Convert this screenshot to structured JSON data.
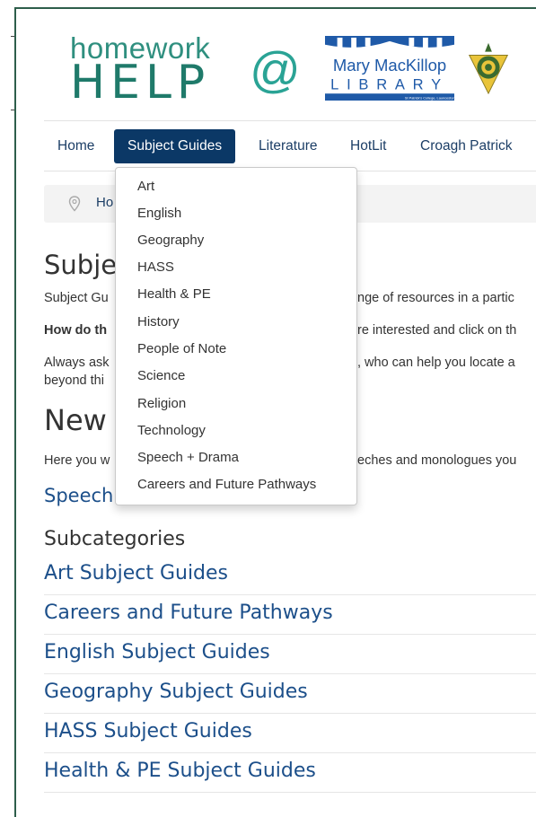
{
  "header": {
    "homework_word": "homework",
    "help_word": "HELP",
    "at_sign": "@",
    "library_name_line1": "Mary MacKillop",
    "library_name_line2": "LIBRARY",
    "library_subtext": "St Patrick's College, Launceston",
    "colors": {
      "brand_green": "#2f8f7f",
      "nav_active": "#0b3866",
      "link_blue": "#1c4f8a"
    }
  },
  "nav": {
    "items": [
      "Home",
      "Subject Guides",
      "Literature",
      "HotLit",
      "Croagh Patrick"
    ],
    "active": "Subject Guides"
  },
  "dropdown": {
    "items": [
      "Art",
      "English",
      "Geography",
      "HASS",
      "Health & PE",
      "History",
      "People of Note",
      "Science",
      "Religion",
      "Technology",
      "Speech + Drama",
      "Careers and Future Pathways"
    ]
  },
  "breadcrumb": {
    "icon": "location-pin-icon",
    "text": "Ho"
  },
  "main": {
    "title": "Subjec",
    "intro_left": "Subject Gu",
    "intro_right": "nge of resources in a partic",
    "how_left": "How do th",
    "how_right": "re interested and click on th",
    "always_left": "Always ask",
    "always_right": ", who can help you locate a",
    "beyond_left": "beyond thi",
    "new_heading": "New",
    "here_left": "Here you w",
    "here_right": "eches and monologues you",
    "speech_link": "Speech"
  },
  "subcategories": {
    "title": "Subcategories",
    "items": [
      "Art Subject Guides",
      "Careers and Future Pathways",
      "English Subject Guides",
      "Geography Subject Guides",
      "HASS Subject Guides",
      "Health & PE Subject Guides"
    ]
  }
}
